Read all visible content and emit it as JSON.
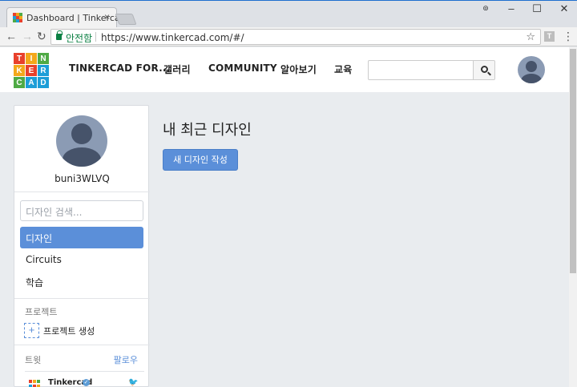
{
  "browser": {
    "tab_title": "Dashboard | Tinkercad",
    "tab_close": "×",
    "secure_label": "안전함",
    "url": "https://www.tinkercad.com/#/",
    "extension_letter": "T",
    "win_minimize": "–",
    "win_maximize": "☐",
    "win_close": "✕"
  },
  "logo": {
    "letters": [
      "T",
      "I",
      "N",
      "K",
      "E",
      "R",
      "C",
      "A",
      "D"
    ],
    "colors": [
      "#e8412c",
      "#f3a81b",
      "#4faa45",
      "#f3a81b",
      "#e8412c",
      "#1c9ed8",
      "#4faa45",
      "#1c9ed8",
      "#1c9ed8"
    ]
  },
  "nav": {
    "items": [
      "TINKERCAD FOR...",
      "갤러리",
      "COMMUNITY",
      "알아보기",
      "교육"
    ]
  },
  "sidebar": {
    "username": "buni3WLVQ",
    "search_placeholder": "디자인 검색...",
    "items": [
      "디자인",
      "Circuits",
      "학습"
    ],
    "projects_label": "프로젝트",
    "create_project": "프로젝트 생성",
    "tweets_label": "트윗",
    "follow_label": "팔로우",
    "tweet_author": "Tinkercad"
  },
  "main": {
    "title": "내 최근 디자인",
    "new_design_button": "새 디자인 작성"
  },
  "colors": {
    "accent": "#5b8fd9",
    "page_bg": "#e9ecef"
  }
}
